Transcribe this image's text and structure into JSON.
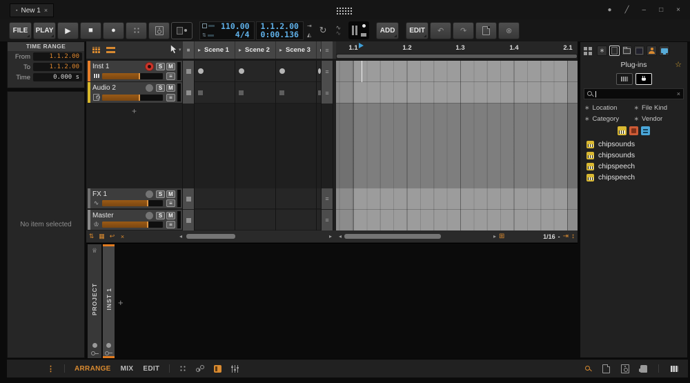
{
  "titlebar": {
    "tab_label": "New 1"
  },
  "icons": {
    "bullet": "▪",
    "close": "×",
    "minimize": "–",
    "maximize": "□",
    "scale": "╱",
    "dot": "●",
    "play": "▶",
    "stop": "■",
    "record": "●",
    "undo": "↶",
    "redo": "↷",
    "delete": "⊗",
    "loop": "↻",
    "curve": "∿",
    "menu": "≡",
    "scene_play": "▸",
    "caret": "▾",
    "left": "◂",
    "right": "▸",
    "stop_all": "⇅",
    "pad": "▦",
    "back": "↩",
    "cross": "×",
    "snap": "⊞",
    "zoom_h": "⇥",
    "zoom_v": "↕",
    "star": "∗",
    "fav": "☆",
    "plus": "+",
    "dash": "-",
    "kebab": "⋮",
    "crown": "♕",
    "crown_master": "♔",
    "metronome": "◭",
    "punch": "⇥"
  },
  "transport": {
    "file": "FILE",
    "play": "PLAY",
    "add": "ADD",
    "edit": "EDIT",
    "tempo": "110.00",
    "time_signature": "4/4",
    "position": "1.1.2.00",
    "time": "0:00.136"
  },
  "time_range": {
    "title": "TIME RANGE",
    "rows": [
      {
        "label": "From",
        "value": "1.1.2.00"
      },
      {
        "label": "To",
        "value": "1.1.2.00"
      },
      {
        "label": "Time",
        "value": "0.000 s"
      }
    ]
  },
  "inspector": {
    "empty": "No item selected"
  },
  "tracks": [
    {
      "name": "Inst 1",
      "solo": "S",
      "mute": "M",
      "color": "#e87f2a",
      "fader": "62%",
      "armed": true,
      "slot": "dot"
    },
    {
      "name": "Audio 2",
      "solo": "S",
      "mute": "M",
      "color": "#d9b92c",
      "fader": "62%",
      "armed": false,
      "slot": "square"
    },
    {
      "name": "FX 1",
      "solo": "S",
      "mute": "M",
      "color": "#707070",
      "fader": "76%",
      "armed": false,
      "slot": "none"
    },
    {
      "name": "Master",
      "solo": "S",
      "mute": "M",
      "color": "#8a8a8a",
      "fader": "76%",
      "armed": false,
      "slot": "none"
    }
  ],
  "scenes": [
    {
      "label": "Scene 1"
    },
    {
      "label": "Scene 2"
    },
    {
      "label": "Scene 3"
    }
  ],
  "ruler": {
    "ticks": [
      "1.1",
      "1.2",
      "1.3",
      "1.4",
      "2.1"
    ]
  },
  "footer": {
    "grid": "1/16",
    "dash": "-"
  },
  "panel_tabs": {
    "project": "PROJECT",
    "inst": "INST 1"
  },
  "browser": {
    "title": "Plug-ins",
    "filters": [
      {
        "label": "Location"
      },
      {
        "label": "File Kind"
      },
      {
        "label": "Category"
      },
      {
        "label": "Vendor"
      }
    ],
    "results": [
      {
        "name": "chipsounds"
      },
      {
        "name": "chipsounds"
      },
      {
        "name": "chipspeech"
      },
      {
        "name": "chipspeech"
      }
    ]
  },
  "statusbar": {
    "arrange": "ARRANGE",
    "mix": "MIX",
    "edit": "EDIT"
  },
  "colors": {
    "accent": "#e0862e",
    "blue": "#5fb0e8",
    "red": "#c8352a"
  }
}
